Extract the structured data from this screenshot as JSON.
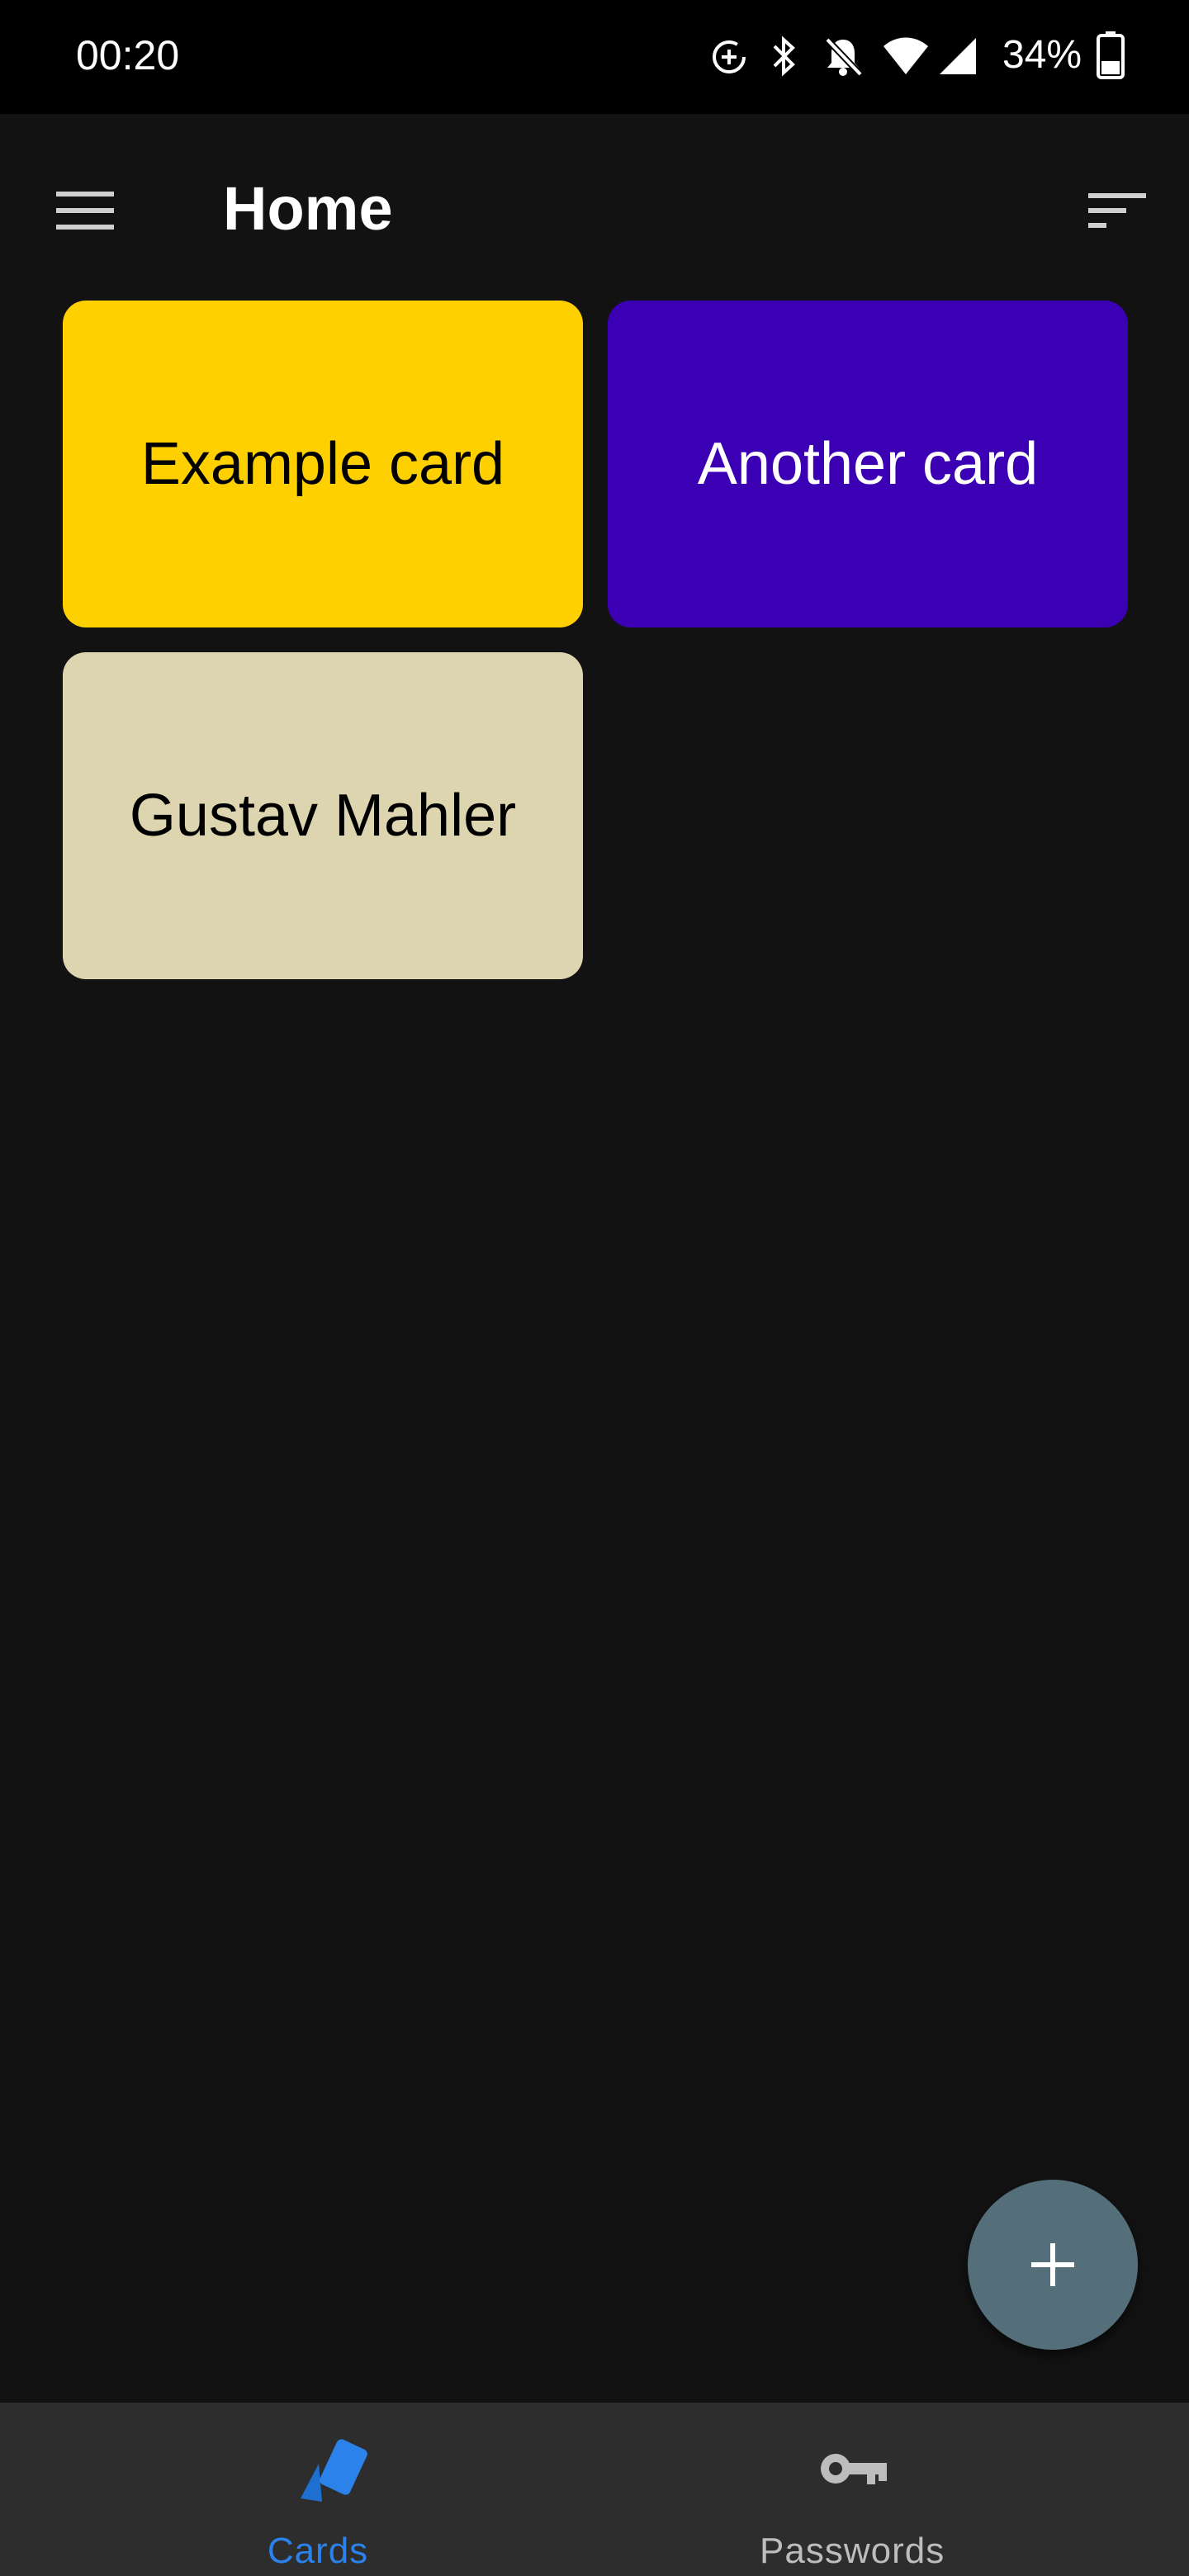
{
  "status_bar": {
    "time": "00:20",
    "battery": "34%",
    "icons": [
      "data-saver-icon",
      "bluetooth-icon",
      "notifications-off-icon",
      "wifi-icon",
      "cell-signal-icon",
      "battery-icon"
    ]
  },
  "app_bar": {
    "title": "Home",
    "left_icon": "menu-icon",
    "right_icon": "sort-icon"
  },
  "cards": [
    {
      "label": "Example card",
      "bg_color": "#ffd000",
      "text_color": "#000000"
    },
    {
      "label": "Another card",
      "bg_color": "#3c00b4",
      "text_color": "#ffffff"
    },
    {
      "label": "Gustav Mahler",
      "bg_color": "#ddd5b0",
      "text_color": "#000000"
    }
  ],
  "fab": {
    "icon": "plus-icon",
    "color": "#546e7a"
  },
  "bottom_nav": {
    "items": [
      {
        "label": "Cards",
        "icon": "cards-icon",
        "active": true,
        "color": "#2a82ea"
      },
      {
        "label": "Passwords",
        "icon": "key-icon",
        "active": false,
        "color": "#bdbdbd"
      }
    ]
  }
}
